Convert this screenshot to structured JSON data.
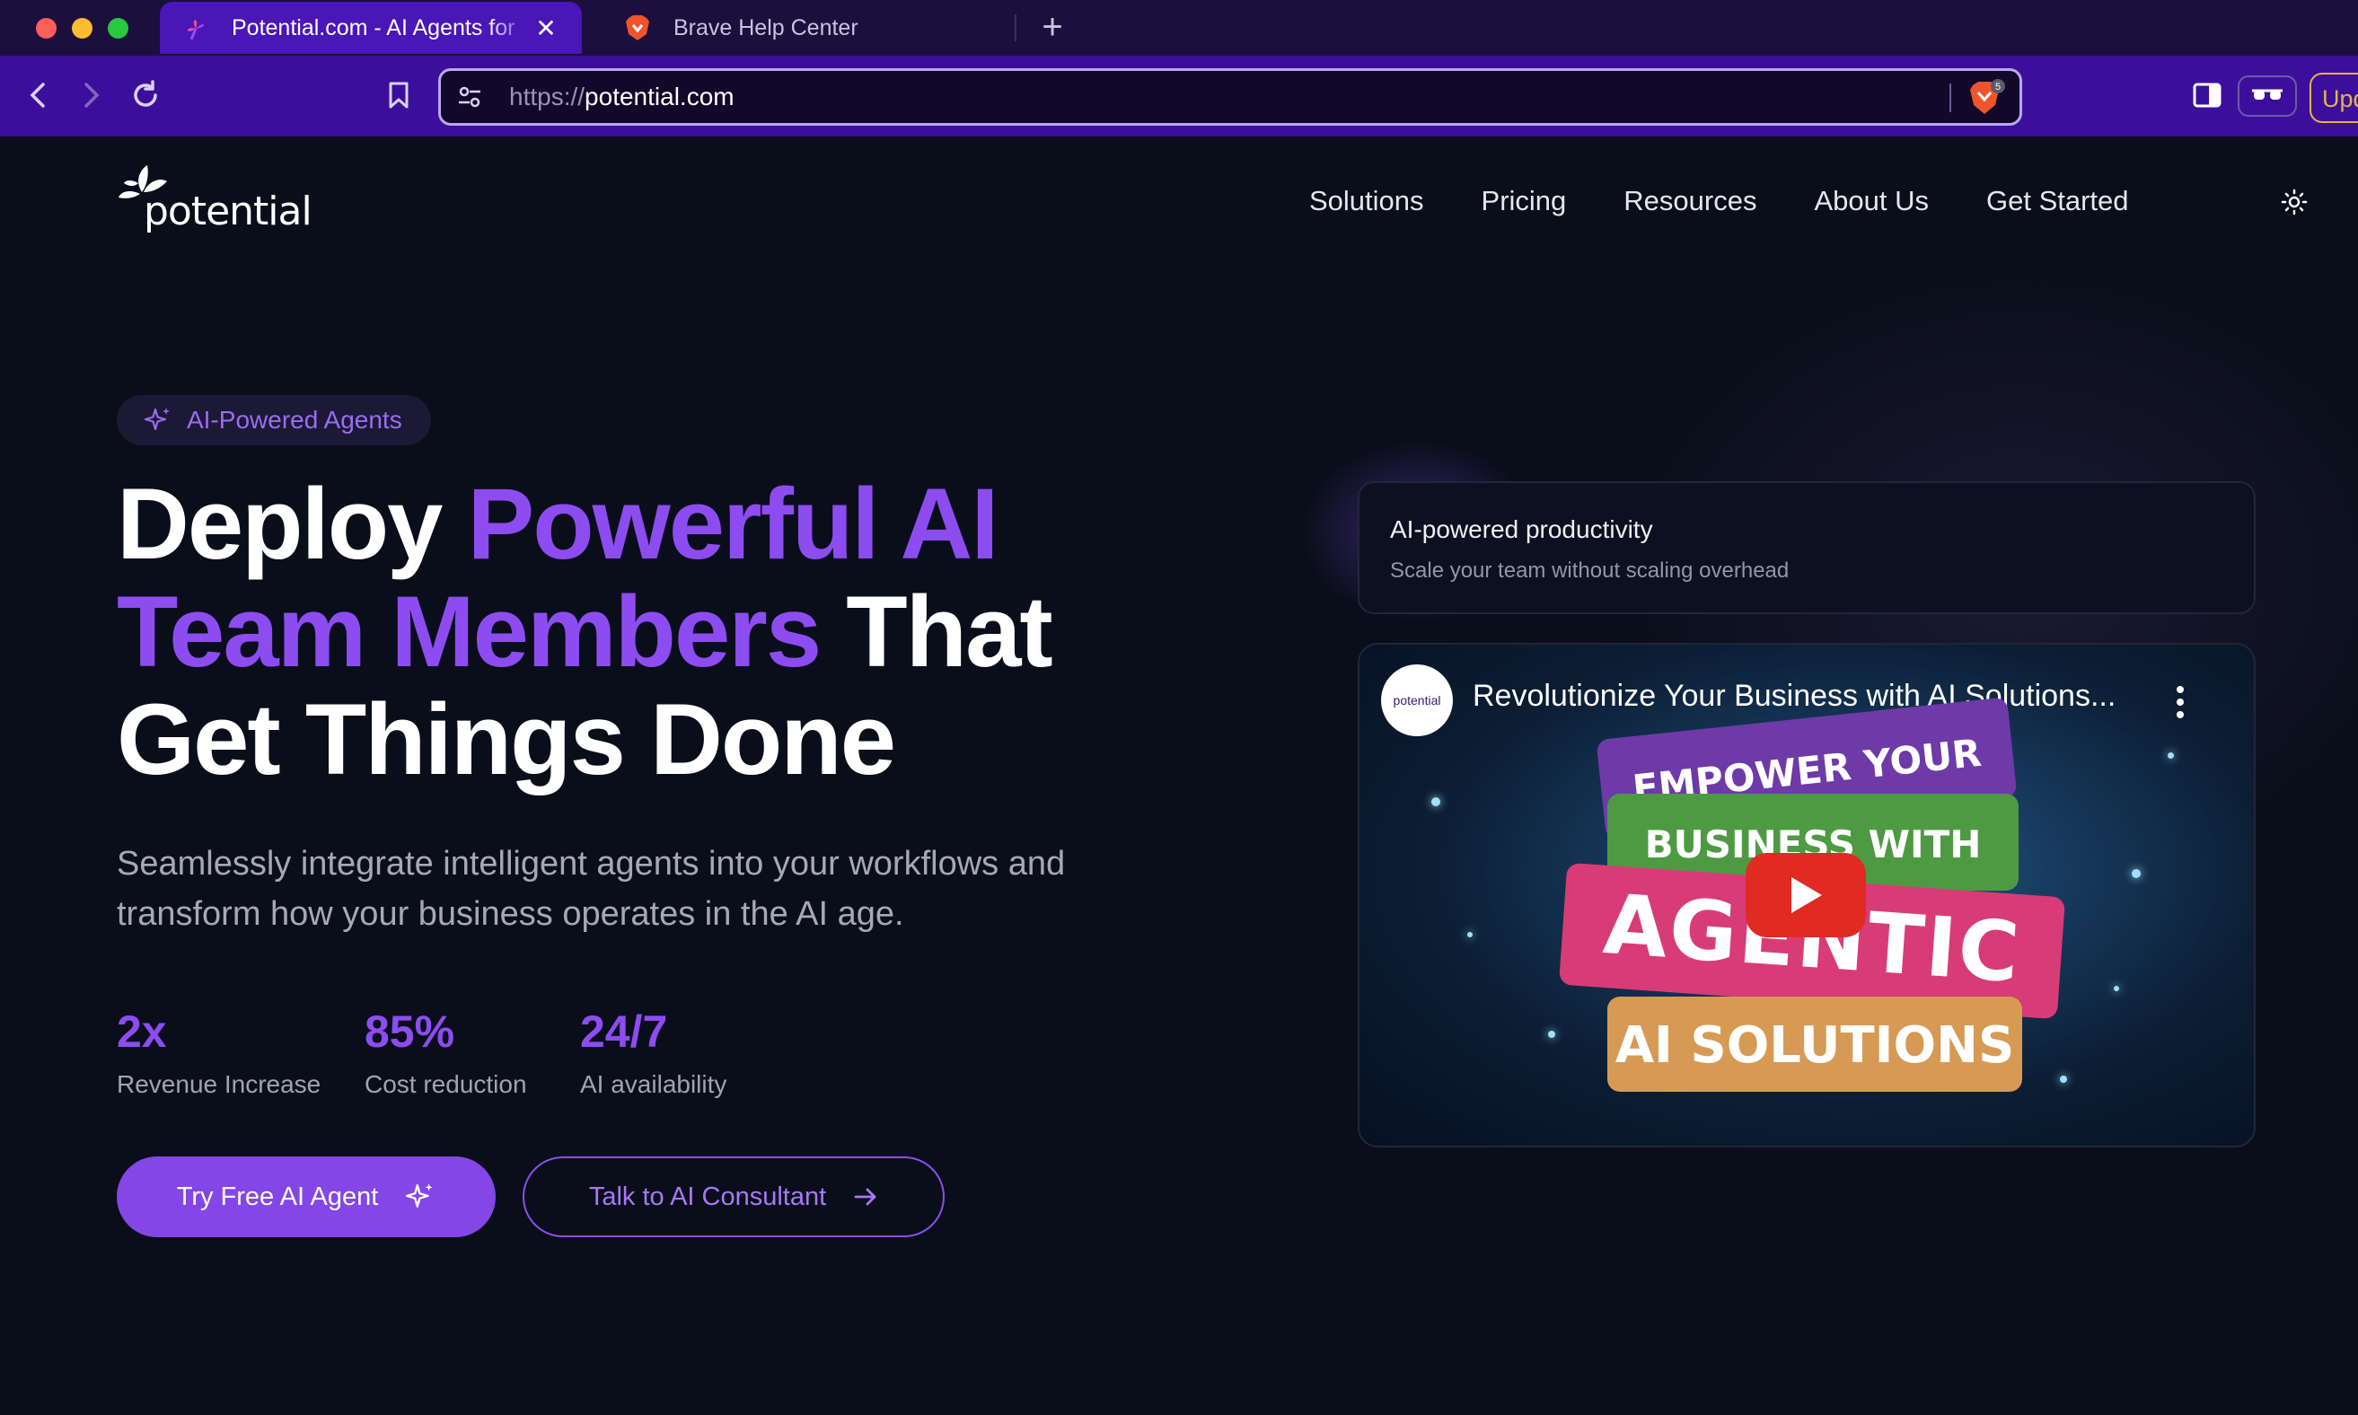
{
  "browser": {
    "tabs": [
      {
        "title": "Potential.com - AI Agents for",
        "active": true,
        "close_label": "✕"
      },
      {
        "title": "Brave Help Center",
        "active": false
      }
    ],
    "new_tab_label": "+",
    "url_protocol": "https://",
    "url_host": "potential.com",
    "shield_count": "5",
    "update_label": "Upd",
    "accent_color": "#3b0f9c"
  },
  "site": {
    "logo_text": "potential",
    "nav": [
      "Solutions",
      "Pricing",
      "Resources",
      "About Us",
      "Get Started"
    ],
    "pill_label": "AI-Powered Agents",
    "headline": {
      "w1": "Deploy ",
      "w2": "Powerful AI",
      "w3": "Team Members",
      "w4": " That",
      "w5": "Get Things Done"
    },
    "subheadline": "Seamlessly integrate intelligent agents into your workflows and transform how your business operates in the AI age.",
    "stats": [
      {
        "value": "2x",
        "label": "Revenue Increase"
      },
      {
        "value": "85%",
        "label": "Cost reduction"
      },
      {
        "value": "24/7",
        "label": "AI availability"
      }
    ],
    "cta_primary": "Try Free AI Agent",
    "cta_secondary": "Talk to AI Consultant",
    "card": {
      "title": "AI-powered productivity",
      "subtitle": "Scale your team without scaling overhead"
    },
    "video": {
      "channel_logo": "potential",
      "title": "Revolutionize Your Business with AI Solutions...",
      "banners": [
        "EMPOWER YOUR",
        "BUSINESS WITH",
        "AGENTIC",
        "AI SOLUTIONS"
      ]
    },
    "accent_purple": "#8d4cf0"
  }
}
